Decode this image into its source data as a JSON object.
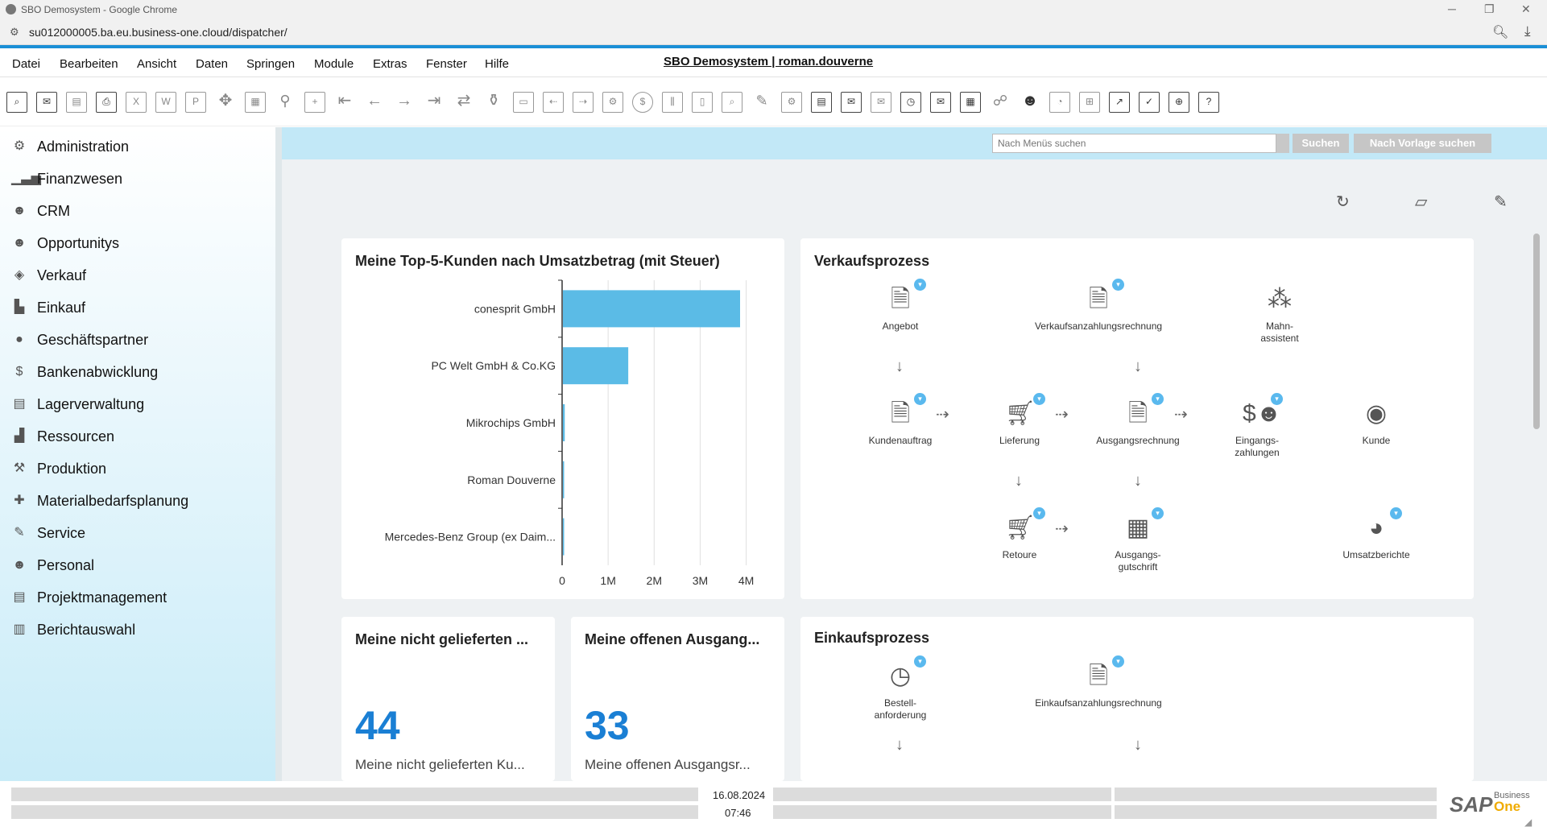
{
  "window": {
    "title": "SBO Demosystem - Google Chrome",
    "min": "─",
    "restore": "❐",
    "close": "✕"
  },
  "address": {
    "url": "su012000005.ba.eu.business-one.cloud/dispatcher/"
  },
  "menu": [
    "Datei",
    "Bearbeiten",
    "Ansicht",
    "Daten",
    "Springen",
    "Module",
    "Extras",
    "Fenster",
    "Hilfe"
  ],
  "app_title": "SBO Demosystem | roman.douverne",
  "sidebar": [
    "Administration",
    "Finanzwesen",
    "CRM",
    "Opportunitys",
    "Verkauf",
    "Einkauf",
    "Geschäftspartner",
    "Bankenabwicklung",
    "Lagerverwaltung",
    "Ressourcen",
    "Produktion",
    "Materialbedarfsplanung",
    "Service",
    "Personal",
    "Projektmanagement",
    "Berichtauswahl"
  ],
  "search": {
    "placeholder": "Nach Menüs suchen",
    "search_btn": "Suchen",
    "template_btn": "Nach Vorlage suchen"
  },
  "top5": {
    "title": "Meine Top-5-Kunden nach Umsatzbetrag (mit Steuer)"
  },
  "chart_data": {
    "type": "bar",
    "orientation": "horizontal",
    "title": "Meine Top-5-Kunden nach Umsatzbetrag (mit Steuer)",
    "categories": [
      "conesprit GmbH",
      "PC Welt GmbH & Co.KG",
      "Mikrochips GmbH",
      "Roman Douverne",
      "Mercedes-Benz Group (ex Daim..."
    ],
    "values": [
      3850000,
      1420000,
      40000,
      10000,
      5000
    ],
    "xlim": [
      0,
      4200000
    ],
    "ticks": [
      "0",
      "1M",
      "2M",
      "3M",
      "4M"
    ],
    "tick_values": [
      0,
      1000000,
      2000000,
      3000000,
      4000000
    ],
    "color": "#5bbbe6",
    "grid": true
  },
  "sales": {
    "title": "Verkaufsprozess",
    "nodes": {
      "angebot": "Angebot",
      "anzahlung": "Verkaufsanzahlungsrechnung",
      "mahn1": "Mahn-",
      "mahn2": "assistent",
      "kundenauftrag": "Kundenauftrag",
      "lieferung": "Lieferung",
      "ausgangsrechnung": "Ausgangsrechnung",
      "eing1": "Eingangs-",
      "eing2": "zahlungen",
      "kunde": "Kunde",
      "retoure": "Retoure",
      "gut1": "Ausgangs-",
      "gut2": "gutschrift",
      "umsatz": "Umsatzberichte"
    }
  },
  "kpi1": {
    "title": "Meine nicht gelieferten ...",
    "value": "44",
    "sub": "Meine nicht gelieferten Ku..."
  },
  "kpi2": {
    "title": "Meine offenen Ausgang...",
    "value": "33",
    "sub": "Meine offenen Ausgangsr..."
  },
  "purchase": {
    "title": "Einkaufsprozess",
    "nodes": {
      "best1": "Bestell-",
      "best2": "anforderung",
      "anzahlung": "Einkaufsanzahlungsrechnung"
    }
  },
  "footer": {
    "date": "16.08.2024",
    "time": "07:46",
    "brand": "SAP",
    "brand_sub1": "Business",
    "brand_sub2": "One"
  }
}
